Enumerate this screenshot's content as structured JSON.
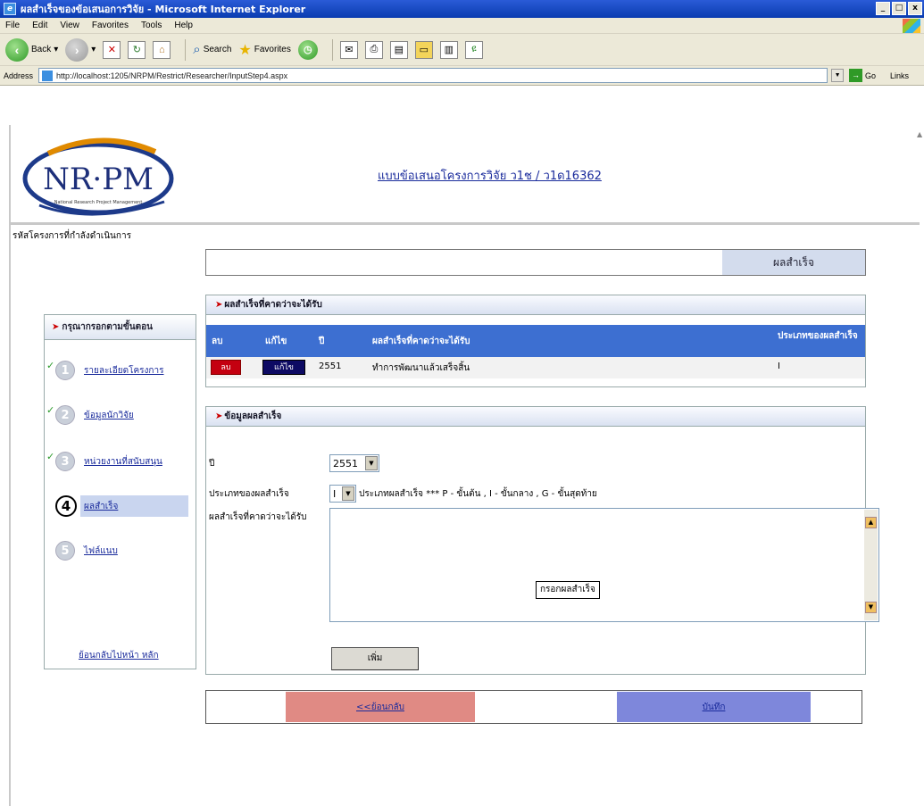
{
  "window": {
    "title": "ผลสำเร็จของข้อเสนอการวิจัย - Microsoft Internet Explorer",
    "controls": [
      "_",
      "□",
      "x"
    ]
  },
  "menu": [
    "File",
    "Edit",
    "View",
    "Favorites",
    "Tools",
    "Help"
  ],
  "toolbar": {
    "back_label": "Back",
    "search_label": "Search",
    "favorites_label": "Favorites"
  },
  "address": {
    "label": "Address",
    "url": "http://localhost:1205/NRPM/Restrict/Researcher/InputStep4.aspx",
    "go_label": "Go",
    "links_label": "Links"
  },
  "header": {
    "logo_text": "NR·PM",
    "logo_sub": "National Research Project Management",
    "title": "แบบข้อเสนอโครงการวิจัย ว1ช / ว1ด16362",
    "project_label": "รหัสโครงการที่กำลังดำเนินการ"
  },
  "result_tab": "ผลสำเร็จ",
  "sidebar": {
    "header": "กรุณากรอกตามขั้นตอน",
    "steps": [
      {
        "num": "1",
        "label": "รายละเอียดโครงการ",
        "done": true
      },
      {
        "num": "2",
        "label": "ข้อมูลนักวิจัย",
        "done": true
      },
      {
        "num": "3",
        "label": "หน่วยงานที่สนับสนุน",
        "done": true
      },
      {
        "num": "4",
        "label": "ผลสำเร็จ",
        "done": false
      },
      {
        "num": "5",
        "label": "ไฟล์แนบ",
        "done": false
      }
    ],
    "back_home": "ย้อนกลับไปหน้า หลัก"
  },
  "expected_panel": {
    "title": "ผลสำเร็จที่คาดว่าจะได้รับ",
    "columns": [
      "ลบ",
      "แก้ไข",
      "ปี",
      "ผลสำเร็จที่คาดว่าจะได้รับ",
      "ประเภทของผลสำเร็จ"
    ],
    "rows": [
      {
        "delete": "ลบ",
        "edit": "แก้ไข",
        "year": "2551",
        "result": "ทำการพัฒนาแล้วเสร็จสิ้น",
        "type": "I"
      }
    ]
  },
  "info_panel": {
    "title": "ข้อมูลผลสำเร็จ",
    "year_label": "ปี",
    "year_value": "2551",
    "type_label": "ประเภทของผลสำเร็จ",
    "type_value": "I",
    "type_hint": "ประเภทผลสำเร็จ   *** P - ขั้นต้น , I - ขั้นกลาง , G - ขั้นสุดท้าย",
    "expected_label": "ผลสำเร็จที่คาดว่าจะได้รับ",
    "fill_button": "กรอกผลสำเร็จ",
    "add_button": "เพิ่ม"
  },
  "nav": {
    "back": "<<ย้อนกลับ",
    "save": "บันทึก"
  }
}
